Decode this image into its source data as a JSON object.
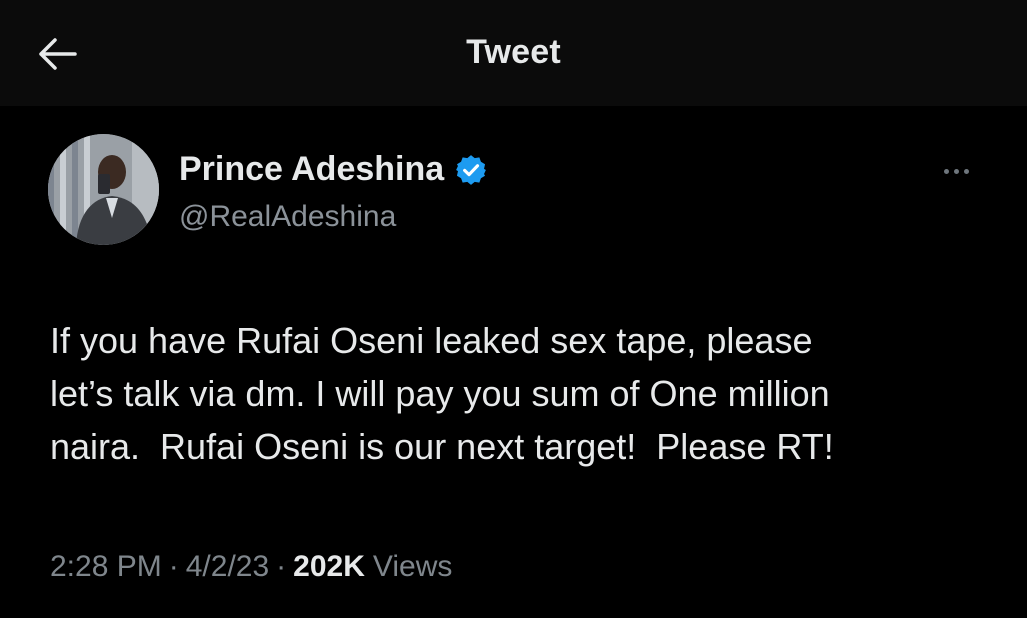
{
  "header": {
    "title": "Tweet",
    "back_icon": "arrow-left-icon"
  },
  "tweet": {
    "author": {
      "name": "Prince Adeshina",
      "handle": "@RealAdeshina",
      "verified": true,
      "verified_color": "#1d9bf0"
    },
    "more_icon": "more-horizontal-icon",
    "text": "If you have Rufai Oseni leaked sex tape, please\nlet’s talk via dm. I will pay you sum of One million\nnaira.  Rufai Oseni is our next target!  Please RT!",
    "meta": {
      "time": "2:28 PM",
      "separator": "·",
      "date": "4/2/23",
      "views_count": "202K",
      "views_label": "Views"
    }
  },
  "colors": {
    "background": "#000000",
    "header_background": "#0b0b0b",
    "primary_text": "#e7e9ea",
    "secondary_text": "#8b9299"
  }
}
